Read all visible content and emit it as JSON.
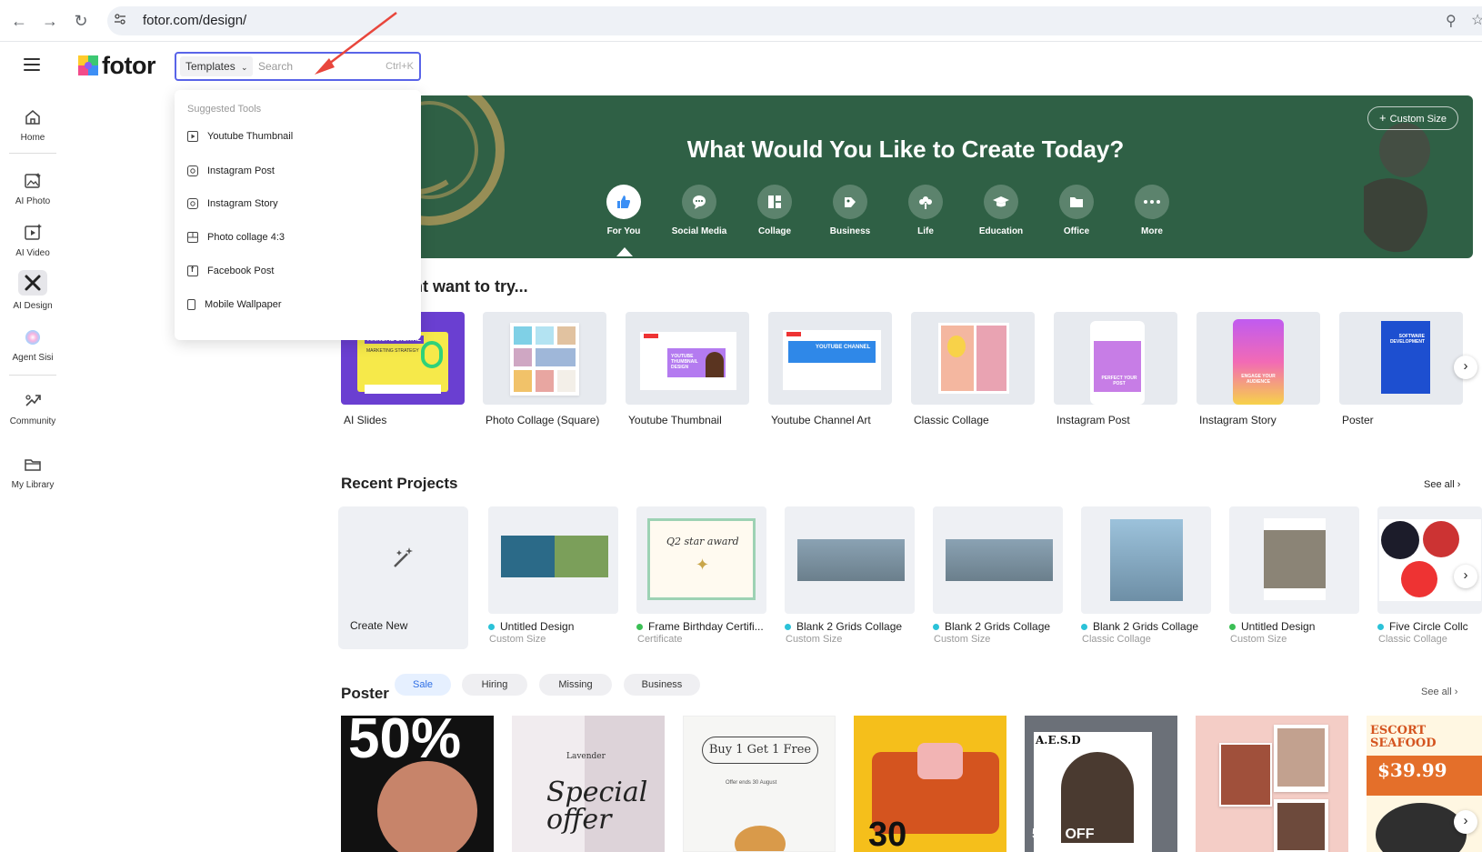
{
  "browser": {
    "url": "fotor.com/design/",
    "back_icon": "arrow-left-icon",
    "forward_icon": "arrow-right-icon",
    "reload_icon": "reload-icon"
  },
  "sidebar": {
    "items": [
      {
        "label": "Home",
        "icon": "home-icon"
      },
      {
        "label": "AI Photo",
        "icon": "ai-photo-icon"
      },
      {
        "label": "AI Video",
        "icon": "ai-video-icon"
      },
      {
        "label": "AI Design",
        "icon": "ai-design-icon"
      },
      {
        "label": "Agent Sisi",
        "icon": "agent-sisi-icon"
      },
      {
        "label": "Community",
        "icon": "community-icon"
      },
      {
        "label": "My Library",
        "icon": "folder-icon"
      }
    ]
  },
  "logo": {
    "text": "fotor"
  },
  "search": {
    "scope": "Templates",
    "placeholder": "Search",
    "shortcut": "Ctrl+K"
  },
  "dropdown": {
    "heading": "Suggested Tools",
    "items": [
      {
        "label": "Youtube Thumbnail",
        "icon": "youtube-icon"
      },
      {
        "label": "Instagram Post",
        "icon": "instagram-icon"
      },
      {
        "label": "Instagram Story",
        "icon": "instagram-icon"
      },
      {
        "label": "Photo collage 4:3",
        "icon": "collage-icon"
      },
      {
        "label": "Facebook Post",
        "icon": "facebook-icon"
      },
      {
        "label": "Mobile Wallpaper",
        "icon": "phone-icon"
      }
    ]
  },
  "hero": {
    "title": "What Would You Like to Create Today?",
    "custom_size": "Custom Size",
    "categories": [
      {
        "label": "For You",
        "icon": "thumbs-up-icon"
      },
      {
        "label": "Social Media",
        "icon": "chat-icon"
      },
      {
        "label": "Collage",
        "icon": "collage-icon"
      },
      {
        "label": "Business",
        "icon": "tag-icon"
      },
      {
        "label": "Life",
        "icon": "flower-icon"
      },
      {
        "label": "Education",
        "icon": "graduation-cap-icon"
      },
      {
        "label": "Office",
        "icon": "folder-icon"
      },
      {
        "label": "More",
        "icon": "more-icon"
      }
    ]
  },
  "try_section": {
    "title": "nt want to try...",
    "cards": [
      {
        "label": "AI Slides"
      },
      {
        "label": "Photo Collage (Square)"
      },
      {
        "label": "Youtube Thumbnail"
      },
      {
        "label": "Youtube Channel Art"
      },
      {
        "label": "Classic Collage"
      },
      {
        "label": "Instagram Post"
      },
      {
        "label": "Instagram Story"
      },
      {
        "label": "Poster"
      }
    ],
    "thumb_text": {
      "ai_slides": "ANNUAL DIGITAL",
      "ai_slides_sub": "MARKETING STRATEGY",
      "yt_thumb": "YOUTUBE THUMBNAIL DESIGN",
      "yt_channel": "YOUTUBE CHANNEL",
      "ig_post": "PERFECT YOUR POST",
      "ig_story": "ENGAGE YOUR AUDIENCE",
      "poster": "SOFTWARE DEVELOPMENT"
    }
  },
  "recent": {
    "title": "Recent Projects",
    "see_all": "See all",
    "create_new": "Create New",
    "projects": [
      {
        "name": "Untitled Design",
        "sub": "Custom Size"
      },
      {
        "name": "Frame Birthday Certifi...",
        "sub": "Certificate"
      },
      {
        "name": "Blank 2 Grids Collage",
        "sub": "Custom Size"
      },
      {
        "name": "Blank 2 Grids Collage",
        "sub": "Custom Size"
      },
      {
        "name": "Blank 2 Grids Collage",
        "sub": "Classic Collage"
      },
      {
        "name": "Untitled Design",
        "sub": "Custom Size"
      },
      {
        "name": "Five Circle Collc",
        "sub": "Classic Collage"
      }
    ],
    "cert_text": "Q2 star award"
  },
  "poster_section": {
    "title": "Poster",
    "see_all": "See all",
    "chips": [
      "Sale",
      "Hiring",
      "Missing",
      "Business"
    ],
    "poster_text": {
      "p1": "50%",
      "p2_small": "Lavender",
      "p2": "Special offer",
      "p3": "Buy 1 Get 1 Free",
      "p3_sub": "Offer ends 30 August",
      "p4": "30",
      "p5": "A.E.S.D",
      "p5_sub": "50% OFF",
      "p7_title": "ESCORT SEAFOOD",
      "p7_price": "$39.99"
    }
  },
  "colors": {
    "accent": "#5964e8",
    "hero_bg": "#2f6045",
    "status_dot": "#2bc2d8",
    "status_dot_green": "#3bbf55"
  }
}
